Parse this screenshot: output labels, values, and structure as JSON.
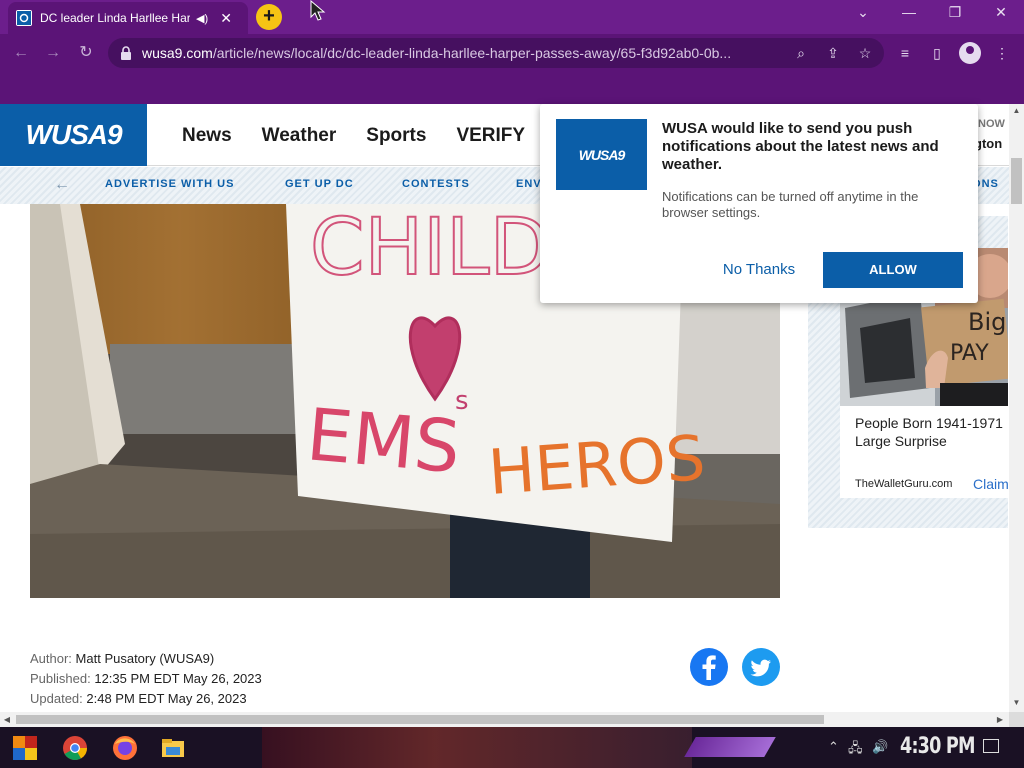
{
  "browser": {
    "tab_title": "DC leader Linda Harllee Harper passes away",
    "tab_audio_icon": "speaker-icon",
    "url_domain": "wusa9.com",
    "url_path": "/article/news/local/dc/dc-leader-linda-harllee-harper-passes-away/65-f3d92ab0-0b..."
  },
  "site": {
    "logo": "WUSA9",
    "nav": [
      "News",
      "Weather",
      "Sports",
      "VERIFY"
    ],
    "now_label": "NOW",
    "region_label": "gton",
    "subnav": [
      "ADVERTISE WITH US",
      "GET UP DC",
      "CONTESTS",
      "ENV",
      "IONS"
    ]
  },
  "article": {
    "sign_text_top": "CHILDREN",
    "sign_text_s": "s",
    "sign_text_ems": "EMS",
    "sign_text_heros": "HEROS",
    "author_label": "Author:",
    "author": "Matt Pusatory (WUSA9)",
    "published_label": "Published:",
    "published": "12:35 PM EDT May 26, 2023",
    "updated_label": "Updated:",
    "updated": "2:48 PM EDT May 26, 2023"
  },
  "ad": {
    "sign_line1": "Big",
    "sign_line2": "PAY",
    "headline_line1": "People Born 1941-1971",
    "headline_line2": "Large Surprise",
    "source": "TheWalletGuru.com",
    "cta": "Claim"
  },
  "popup": {
    "logo": "WUSA9",
    "title": "WUSA would like to send you push notifications about the latest news and weather.",
    "text": "Notifications can be turned off anytime in the browser settings.",
    "no_thanks": "No Thanks",
    "allow": "ALLOW"
  },
  "taskbar": {
    "clock": "4:30 PM"
  },
  "colors": {
    "chrome_purple": "#5b1477",
    "brand_blue": "#0b5ea8",
    "facebook": "#1877f2",
    "twitter": "#1d9bf0"
  }
}
